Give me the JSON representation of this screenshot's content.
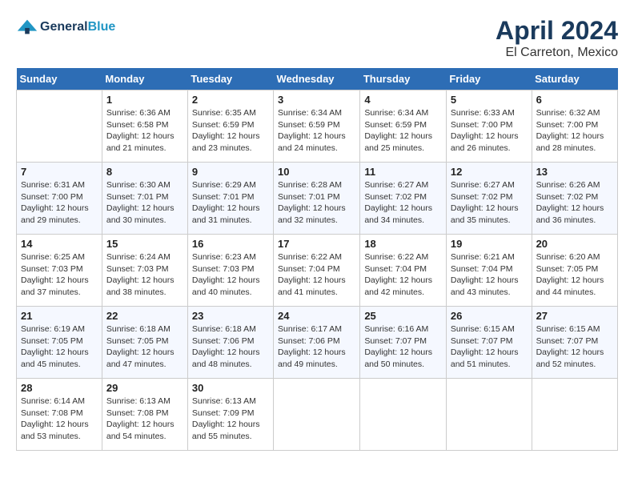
{
  "header": {
    "logo_line1": "General",
    "logo_line2": "Blue",
    "month_year": "April 2024",
    "location": "El Carreton, Mexico"
  },
  "weekdays": [
    "Sunday",
    "Monday",
    "Tuesday",
    "Wednesday",
    "Thursday",
    "Friday",
    "Saturday"
  ],
  "weeks": [
    [
      {
        "day": "",
        "sunrise": "",
        "sunset": "",
        "daylight": ""
      },
      {
        "day": "1",
        "sunrise": "Sunrise: 6:36 AM",
        "sunset": "Sunset: 6:58 PM",
        "daylight": "Daylight: 12 hours and 21 minutes."
      },
      {
        "day": "2",
        "sunrise": "Sunrise: 6:35 AM",
        "sunset": "Sunset: 6:59 PM",
        "daylight": "Daylight: 12 hours and 23 minutes."
      },
      {
        "day": "3",
        "sunrise": "Sunrise: 6:34 AM",
        "sunset": "Sunset: 6:59 PM",
        "daylight": "Daylight: 12 hours and 24 minutes."
      },
      {
        "day": "4",
        "sunrise": "Sunrise: 6:34 AM",
        "sunset": "Sunset: 6:59 PM",
        "daylight": "Daylight: 12 hours and 25 minutes."
      },
      {
        "day": "5",
        "sunrise": "Sunrise: 6:33 AM",
        "sunset": "Sunset: 7:00 PM",
        "daylight": "Daylight: 12 hours and 26 minutes."
      },
      {
        "day": "6",
        "sunrise": "Sunrise: 6:32 AM",
        "sunset": "Sunset: 7:00 PM",
        "daylight": "Daylight: 12 hours and 28 minutes."
      }
    ],
    [
      {
        "day": "7",
        "sunrise": "Sunrise: 6:31 AM",
        "sunset": "Sunset: 7:00 PM",
        "daylight": "Daylight: 12 hours and 29 minutes."
      },
      {
        "day": "8",
        "sunrise": "Sunrise: 6:30 AM",
        "sunset": "Sunset: 7:01 PM",
        "daylight": "Daylight: 12 hours and 30 minutes."
      },
      {
        "day": "9",
        "sunrise": "Sunrise: 6:29 AM",
        "sunset": "Sunset: 7:01 PM",
        "daylight": "Daylight: 12 hours and 31 minutes."
      },
      {
        "day": "10",
        "sunrise": "Sunrise: 6:28 AM",
        "sunset": "Sunset: 7:01 PM",
        "daylight": "Daylight: 12 hours and 32 minutes."
      },
      {
        "day": "11",
        "sunrise": "Sunrise: 6:27 AM",
        "sunset": "Sunset: 7:02 PM",
        "daylight": "Daylight: 12 hours and 34 minutes."
      },
      {
        "day": "12",
        "sunrise": "Sunrise: 6:27 AM",
        "sunset": "Sunset: 7:02 PM",
        "daylight": "Daylight: 12 hours and 35 minutes."
      },
      {
        "day": "13",
        "sunrise": "Sunrise: 6:26 AM",
        "sunset": "Sunset: 7:02 PM",
        "daylight": "Daylight: 12 hours and 36 minutes."
      }
    ],
    [
      {
        "day": "14",
        "sunrise": "Sunrise: 6:25 AM",
        "sunset": "Sunset: 7:03 PM",
        "daylight": "Daylight: 12 hours and 37 minutes."
      },
      {
        "day": "15",
        "sunrise": "Sunrise: 6:24 AM",
        "sunset": "Sunset: 7:03 PM",
        "daylight": "Daylight: 12 hours and 38 minutes."
      },
      {
        "day": "16",
        "sunrise": "Sunrise: 6:23 AM",
        "sunset": "Sunset: 7:03 PM",
        "daylight": "Daylight: 12 hours and 40 minutes."
      },
      {
        "day": "17",
        "sunrise": "Sunrise: 6:22 AM",
        "sunset": "Sunset: 7:04 PM",
        "daylight": "Daylight: 12 hours and 41 minutes."
      },
      {
        "day": "18",
        "sunrise": "Sunrise: 6:22 AM",
        "sunset": "Sunset: 7:04 PM",
        "daylight": "Daylight: 12 hours and 42 minutes."
      },
      {
        "day": "19",
        "sunrise": "Sunrise: 6:21 AM",
        "sunset": "Sunset: 7:04 PM",
        "daylight": "Daylight: 12 hours and 43 minutes."
      },
      {
        "day": "20",
        "sunrise": "Sunrise: 6:20 AM",
        "sunset": "Sunset: 7:05 PM",
        "daylight": "Daylight: 12 hours and 44 minutes."
      }
    ],
    [
      {
        "day": "21",
        "sunrise": "Sunrise: 6:19 AM",
        "sunset": "Sunset: 7:05 PM",
        "daylight": "Daylight: 12 hours and 45 minutes."
      },
      {
        "day": "22",
        "sunrise": "Sunrise: 6:18 AM",
        "sunset": "Sunset: 7:05 PM",
        "daylight": "Daylight: 12 hours and 47 minutes."
      },
      {
        "day": "23",
        "sunrise": "Sunrise: 6:18 AM",
        "sunset": "Sunset: 7:06 PM",
        "daylight": "Daylight: 12 hours and 48 minutes."
      },
      {
        "day": "24",
        "sunrise": "Sunrise: 6:17 AM",
        "sunset": "Sunset: 7:06 PM",
        "daylight": "Daylight: 12 hours and 49 minutes."
      },
      {
        "day": "25",
        "sunrise": "Sunrise: 6:16 AM",
        "sunset": "Sunset: 7:07 PM",
        "daylight": "Daylight: 12 hours and 50 minutes."
      },
      {
        "day": "26",
        "sunrise": "Sunrise: 6:15 AM",
        "sunset": "Sunset: 7:07 PM",
        "daylight": "Daylight: 12 hours and 51 minutes."
      },
      {
        "day": "27",
        "sunrise": "Sunrise: 6:15 AM",
        "sunset": "Sunset: 7:07 PM",
        "daylight": "Daylight: 12 hours and 52 minutes."
      }
    ],
    [
      {
        "day": "28",
        "sunrise": "Sunrise: 6:14 AM",
        "sunset": "Sunset: 7:08 PM",
        "daylight": "Daylight: 12 hours and 53 minutes."
      },
      {
        "day": "29",
        "sunrise": "Sunrise: 6:13 AM",
        "sunset": "Sunset: 7:08 PM",
        "daylight": "Daylight: 12 hours and 54 minutes."
      },
      {
        "day": "30",
        "sunrise": "Sunrise: 6:13 AM",
        "sunset": "Sunset: 7:09 PM",
        "daylight": "Daylight: 12 hours and 55 minutes."
      },
      {
        "day": "",
        "sunrise": "",
        "sunset": "",
        "daylight": ""
      },
      {
        "day": "",
        "sunrise": "",
        "sunset": "",
        "daylight": ""
      },
      {
        "day": "",
        "sunrise": "",
        "sunset": "",
        "daylight": ""
      },
      {
        "day": "",
        "sunrise": "",
        "sunset": "",
        "daylight": ""
      }
    ]
  ]
}
